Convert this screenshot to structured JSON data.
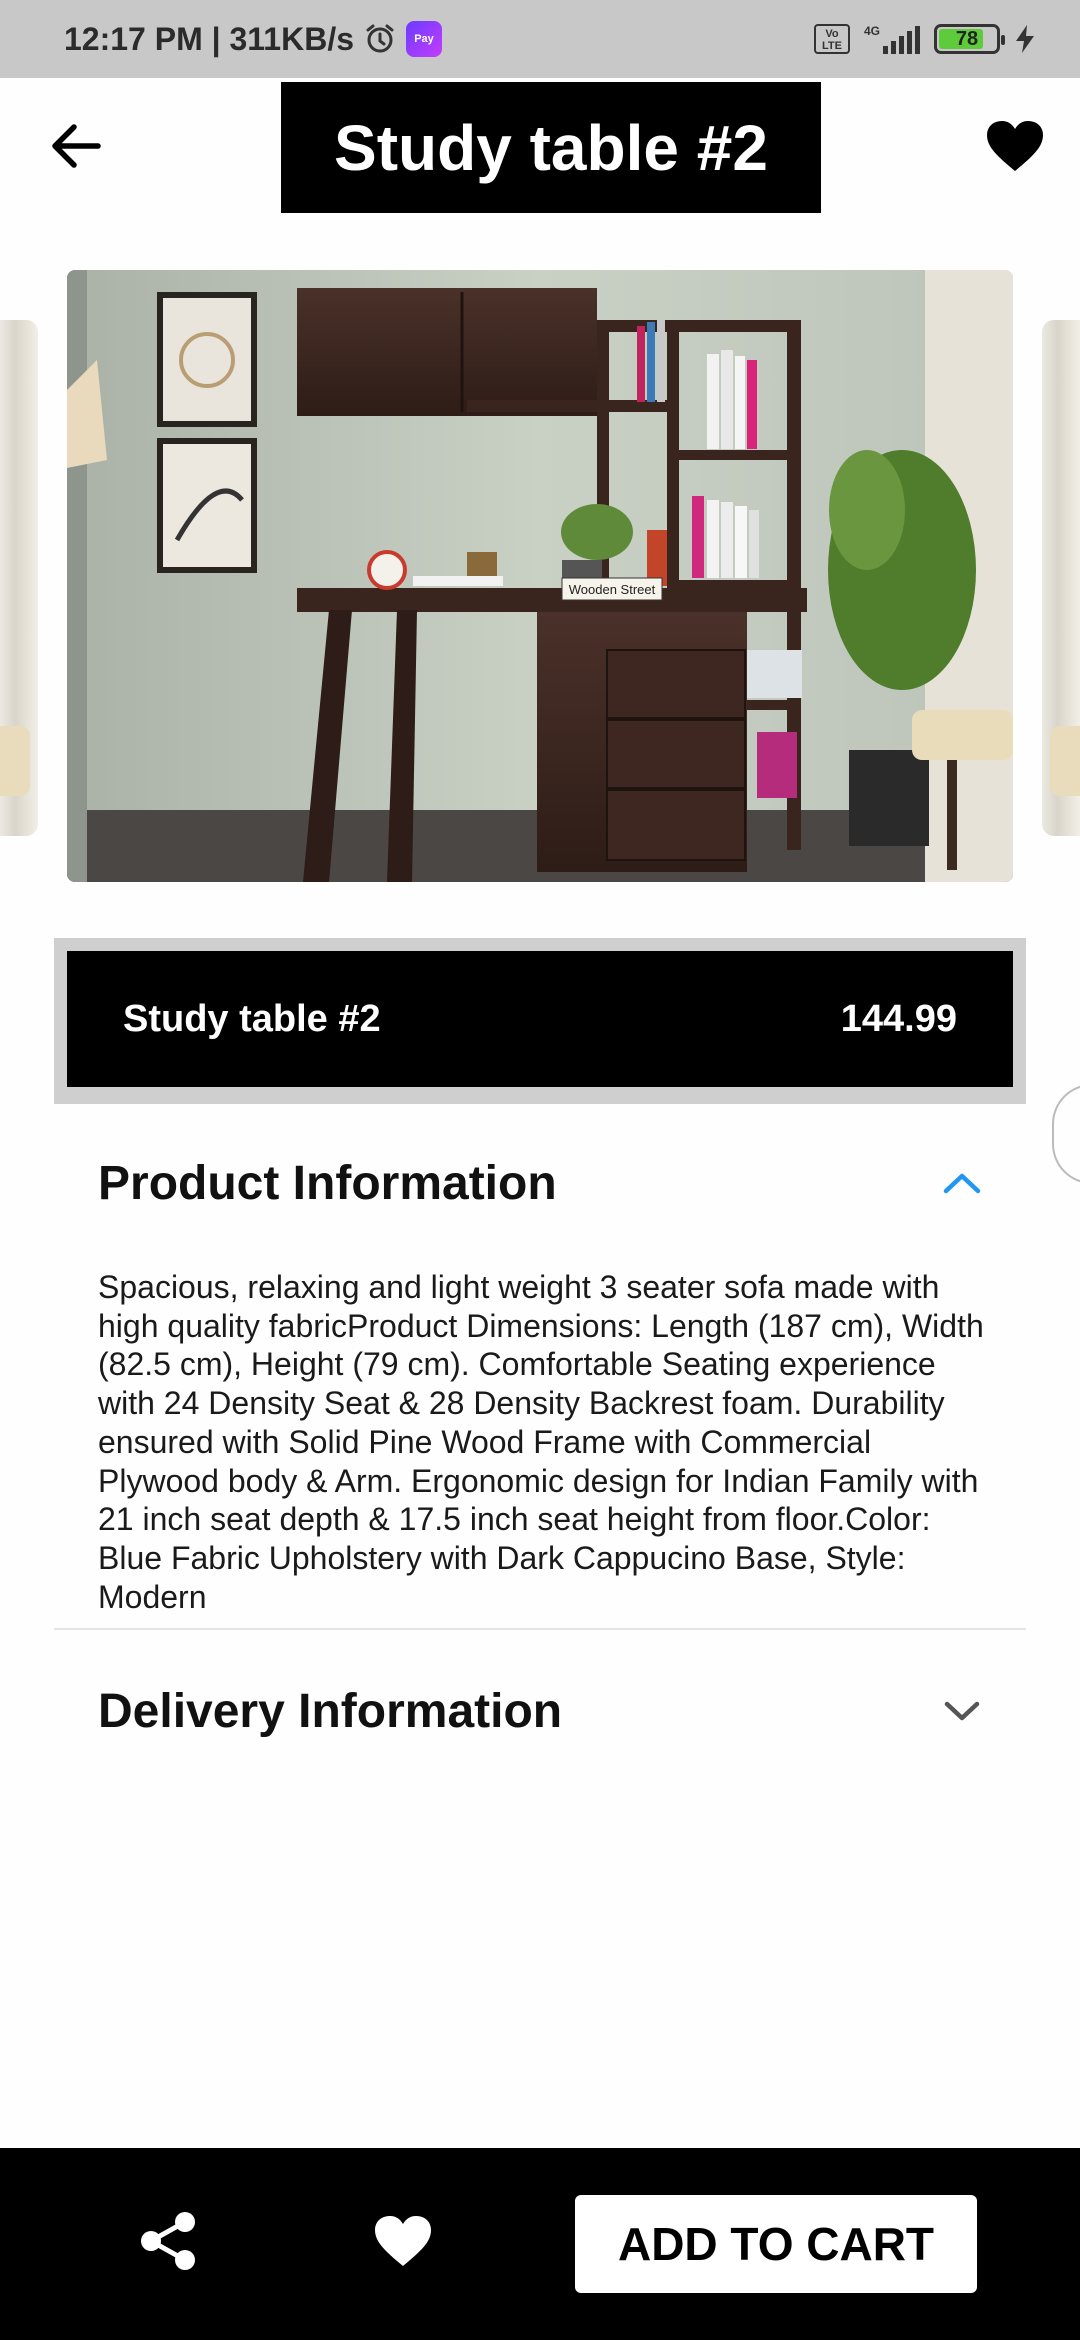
{
  "status_bar": {
    "time": "12:17 PM | 311KB/s",
    "volte_label": "Vo LTE",
    "network_label": "4G",
    "battery_level": "78"
  },
  "header": {
    "title": "Study table #2",
    "back_icon": "arrow-left-icon",
    "favorite_icon": "heart-icon"
  },
  "gallery": {
    "sign_text": "Wooden Street"
  },
  "product": {
    "name": "Study table #2",
    "price": "144.99"
  },
  "sections": [
    {
      "title": "Product Information",
      "expanded": true,
      "body": "Spacious, relaxing and light weight 3 seater sofa made with high quality fabricProduct Dimensions: Length (187 cm), Width (82.5 cm), Height (79 cm). Comfortable Seating experience with 24 Density Seat & 28 Density Backrest foam. Durability ensured with Solid Pine Wood Frame with Commercial Plywood body & Arm. Ergonomic design for Indian Family with 21 inch seat depth & 17.5 inch seat height from floor.Color: Blue Fabric Upholstery with Dark Cappucino Base, Style: Modern"
    },
    {
      "title": "Delivery Information",
      "expanded": false
    }
  ],
  "bottom_bar": {
    "share_icon": "share-icon",
    "favorite_icon": "heart-icon",
    "add_to_cart_label": "ADD TO CART"
  },
  "colors": {
    "accent": "#2196f3",
    "bar_background": "#000000",
    "battery_fill": "#5ecb3a"
  }
}
